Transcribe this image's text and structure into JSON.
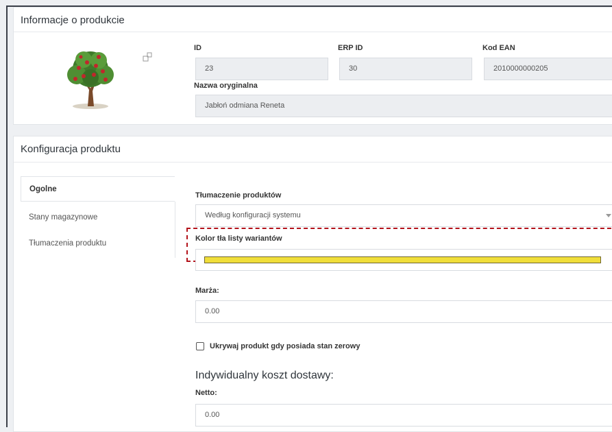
{
  "product_info": {
    "title": "Informacje o produkcie",
    "image_alt": "Jabłoń",
    "id_label": "ID",
    "id_value": "23",
    "erp_label": "ERP ID",
    "erp_value": "30",
    "ean_label": "Kod EAN",
    "ean_value": "2010000000205",
    "name_label": "Nazwa oryginalna",
    "name_value": "Jabłoń odmiana Reneta"
  },
  "config": {
    "title": "Konfiguracja produktu",
    "tabs": [
      {
        "label": "Ogolne",
        "active": true
      },
      {
        "label": "Stany magazynowe",
        "active": false
      },
      {
        "label": "Tłumaczenia produktu",
        "active": false
      }
    ],
    "translation_label": "Tłumaczenie produktów",
    "translation_value": "Według konfiguracji systemu",
    "variant_color_label": "Kolor tła listy wariantów",
    "variant_color_value": "#f0de3a",
    "margin_label": "Marża:",
    "margin_value": "0.00",
    "hide_zero_label": "Ukrywaj produkt gdy posiada stan zerowy",
    "hide_zero_checked": false,
    "delivery_heading": "Indywidualny koszt dostawy:",
    "netto_label": "Netto:",
    "netto_value": "0.00"
  },
  "colors": {
    "highlight_border": "#b3121a",
    "accent_yellow": "#f0de3a"
  }
}
